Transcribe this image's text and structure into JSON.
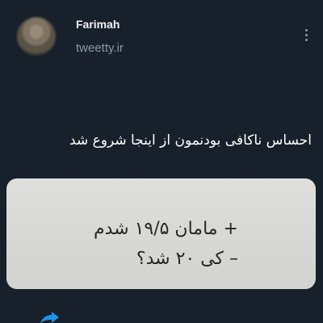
{
  "user": {
    "display_name": "Farimah",
    "handle": "tweetty.ir"
  },
  "icons": {
    "avatar": "profile-avatar",
    "more": "more-vertical-icon",
    "share": "share-icon"
  },
  "tweet": {
    "text": "احساس ناکافی بودنمون از اینجا شروع شد",
    "media_lines": [
      "+ مامان ۱۹/۵ شدم",
      "– کی ۲۰ شد؟"
    ]
  },
  "colors": {
    "background": "#17202b",
    "primary_text": "#ffffff",
    "secondary_text": "#8b98a5",
    "media_background": "#d8d9d6",
    "media_text": "#262626",
    "accent": "#1d9bf0"
  }
}
